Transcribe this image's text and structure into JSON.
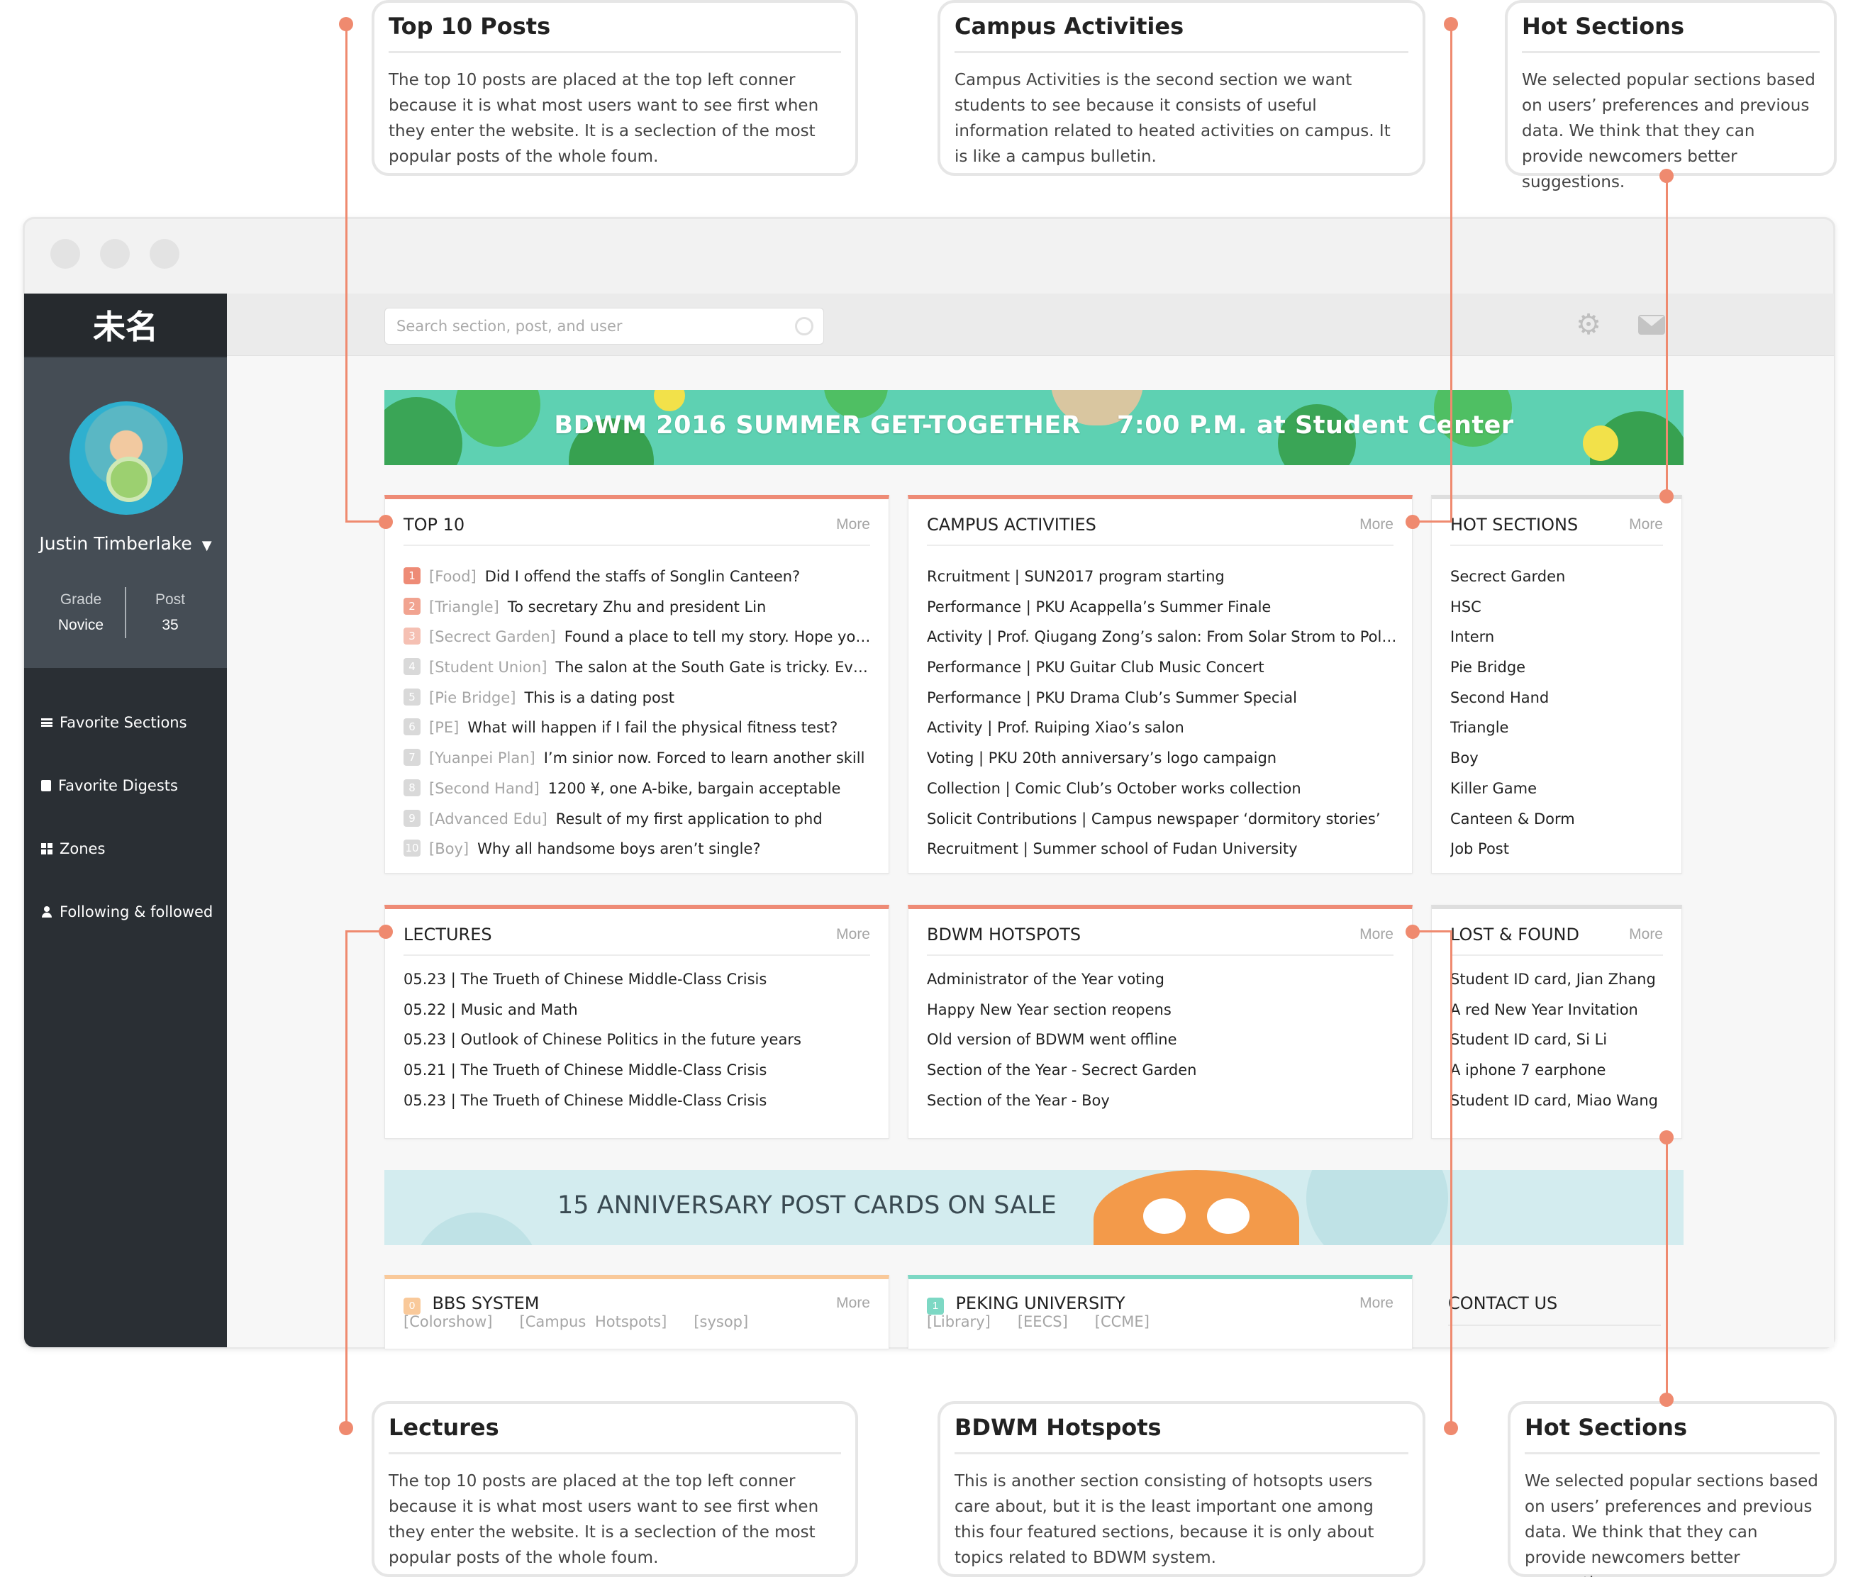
{
  "annotations": {
    "top10": {
      "title": "Top 10 Posts",
      "body": "The top 10 posts are placed at the top left conner because it is what most users want to see first when they enter the website. It is a seclection of the most popular posts of the whole foum."
    },
    "campus": {
      "title": "Campus Activities",
      "body": "Campus Activities is the second section we want students to see because it consists of useful information related to heated activities on campus. It is like a campus bulletin."
    },
    "hot_top": {
      "title": "Hot Sections",
      "body": "We selected popular sections based on users’ preferences and previous data. We think that they can provide newcomers better suggestions."
    },
    "lectures": {
      "title": "Lectures",
      "body": "The top 10 posts are placed at the top left conner because it is what most users want to see first when they enter the website. It is a seclection of the most popular posts of the whole foum."
    },
    "hotspots": {
      "title": "BDWM Hotspots",
      "body": "This is another section consisting of hotsopts users care about, but it is the least important one among this four featured sections, because it is only about topics related to BDWM system."
    },
    "hot_bottom": {
      "title": "Hot Sections",
      "body": "We selected popular sections based on users’ preferences and previous data. We think that they can provide newcomers better suggestions."
    }
  },
  "sidebar": {
    "logo": "未名",
    "user_name": "Justin Timberlake",
    "grade_label": "Grade",
    "grade_value": "Novice",
    "post_label": "Post",
    "post_value": "35",
    "menu": [
      {
        "label": "Favorite Sections",
        "icon": "list-icon"
      },
      {
        "label": "Favorite Digests",
        "icon": "book-icon"
      },
      {
        "label": "Zones",
        "icon": "grid-icon"
      },
      {
        "label": "Following & followed",
        "icon": "person-icon"
      }
    ]
  },
  "topbar": {
    "search_placeholder": "Search section, post, and user"
  },
  "banner_top": {
    "text": "BDWM 2016 SUMMER GET-TOGETHER    7:00 P.M. at Student Center"
  },
  "banner_bottom": {
    "text": "15 ANNIVERSARY POST CARDS ON SALE"
  },
  "more_label": "More",
  "top10": {
    "title": "TOP 10",
    "items": [
      {
        "rank": "1",
        "tag": "[Food]",
        "text": "Did I offend the staffs of Songlin Canteen?"
      },
      {
        "rank": "2",
        "tag": "[Triangle]",
        "text": "To secretary Zhu and president Lin"
      },
      {
        "rank": "3",
        "tag": "[Secrect Garden]",
        "text": "Found a place to tell my story. Hope you…"
      },
      {
        "rank": "4",
        "tag": "[Student Union]",
        "text": "The salon at the South Gate is tricky. Eve…"
      },
      {
        "rank": "5",
        "tag": "[Pie Bridge]",
        "text": "This is a dating post"
      },
      {
        "rank": "6",
        "tag": "[PE]",
        "text": "What will happen if I fail the physical fitness test?"
      },
      {
        "rank": "7",
        "tag": "[Yuanpei Plan]",
        "text": "I’m sinior now. Forced to learn another skill"
      },
      {
        "rank": "8",
        "tag": "[Second Hand]",
        "text": "1200 ¥, one A-bike, bargain acceptable"
      },
      {
        "rank": "9",
        "tag": "[Advanced Edu]",
        "text": "Result of my first application to phd"
      },
      {
        "rank": "10",
        "tag": "[Boy]",
        "text": "Why all handsome boys aren’t single?"
      }
    ],
    "rank_colors": [
      "#ee8b76",
      "#f1a390",
      "#f5c0b3",
      "#d9d9d9",
      "#d9d9d9",
      "#d9d9d9",
      "#d9d9d9",
      "#d9d9d9",
      "#d9d9d9",
      "#d9d9d9"
    ]
  },
  "campus": {
    "title": "CAMPUS ACTIVITIES",
    "items": [
      "Rcruitment | SUN2017 program starting",
      "Performance | PKU Acappella’s Summer Finale",
      "Activity | Prof. Qiugang Zong’s salon: From Solar Strom to Pola…",
      "Performance | PKU Guitar Club Music Concert",
      "Performance | PKU Drama Club’s Summer Special",
      "Activity | Prof. Ruiping Xiao’s salon",
      "Voting | PKU 20th anniversary’s logo campaign",
      "Collection | Comic Club’s October works collection",
      "Solicit Contributions | Campus newspaper ‘dormitory stories’",
      "Recruitment | Summer school of Fudan University"
    ]
  },
  "hot_sections": {
    "title": "HOT SECTIONS",
    "items": [
      "Secrect Garden",
      "HSC",
      "Intern",
      "Pie Bridge",
      "Second Hand",
      "Triangle",
      "Boy",
      "Killer Game",
      "Canteen & Dorm",
      "Job Post"
    ]
  },
  "lectures": {
    "title": "LECTURES",
    "items": [
      "05.23 | The Trueth of Chinese Middle-Class Crisis",
      "05.22 | Music and Math",
      "05.23 | Outlook of Chinese Politics in the future years",
      "05.21 | The Trueth of Chinese Middle-Class Crisis",
      "05.23 | The Trueth of Chinese Middle-Class Crisis"
    ]
  },
  "hotspots": {
    "title": "BDWM HOTSPOTS",
    "items": [
      "Administrator of the Year voting",
      "Happy New Year section reopens",
      "Old version of BDWM went offline",
      "Section of the Year - Secrect Garden",
      "Section of the Year - Boy"
    ]
  },
  "lost_found": {
    "title": "LOST & FOUND",
    "items": [
      "Student ID card, Jian Zhang",
      "A red New Year Invitation",
      "Student ID card, Si Li",
      "A iphone 7 earphone",
      "Student ID card, Miao Wang"
    ]
  },
  "bbs": {
    "badge": "0",
    "title": "BBS SYSTEM",
    "links": "[Colorshow]   [Campus Hotspots]   [sysop]"
  },
  "pku": {
    "badge": "1",
    "title": "PEKING UNIVERSITY",
    "links": "[Library]   [EECS]   [CCME]"
  },
  "contact": {
    "title": "CONTACT US"
  },
  "colors": {
    "accent": "#ee8b76",
    "connector": "#ef8a6f",
    "sidebar": "#2a2f34",
    "bbs": "#f9c99a",
    "pku": "#7dd8c4"
  }
}
